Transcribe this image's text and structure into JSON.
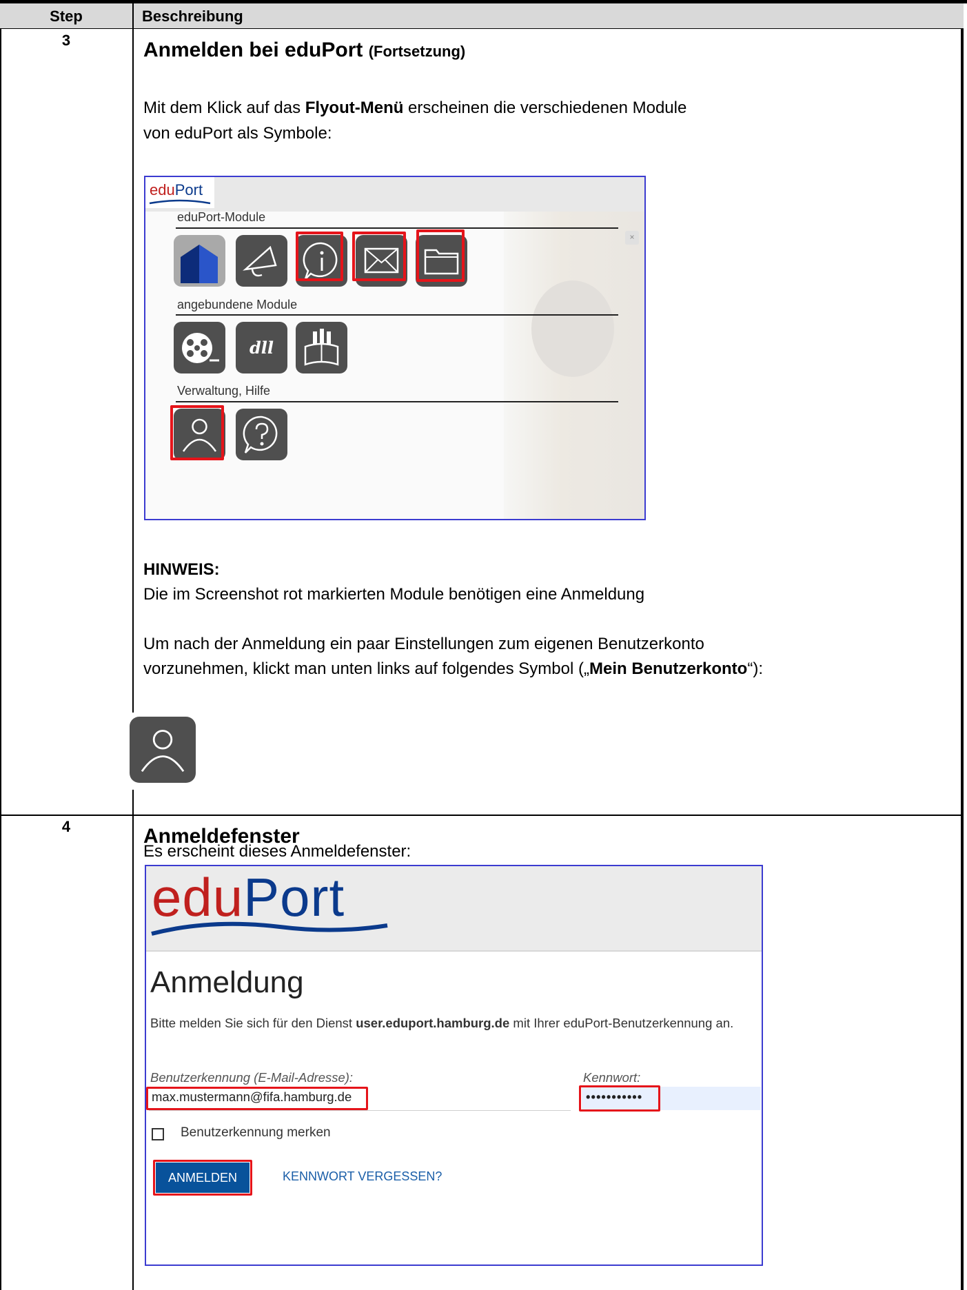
{
  "table": {
    "header_step": "Step",
    "header_description": "Beschreibung"
  },
  "step3": {
    "number": "3",
    "title": "Anmelden bei eduPort",
    "title_suffix": "(Fortsetzung)",
    "para1_a": "Mit dem Klick auf das ",
    "para1_bold": "Flyout-Menü",
    "para1_b": " erscheinen die verschiedenen Module",
    "para1_line2": "von eduPort als Symbole:",
    "flyout": {
      "logo_red": "edu",
      "logo_blue": "Port",
      "close": "×",
      "section1": "eduPort-Module",
      "section2": "angebundene Module",
      "section3": "Verwaltung, Hilfe",
      "icons_section1": [
        "home-icon",
        "megaphone-icon",
        "info-icon",
        "mail-icon",
        "folder-icon"
      ],
      "icons_section2": [
        "film-reel-icon",
        "dll-icon",
        "hamburg-book-icon"
      ],
      "icons_section3": [
        "user-icon",
        "help-icon"
      ],
      "icon_tile_color": "#4f4f4f",
      "highlight_color": "#e5141a",
      "dll_text": "dll"
    },
    "hint_title": "HINWEIS:",
    "hint_text": "Die im Screenshot rot markierten Module benötigen eine Anmeldung",
    "para2_line1": "Um nach der Anmeldung ein paar Einstellungen zum eigenen Benutzerkonto",
    "para2_line2_a": "vorzunehmen, klickt man unten links auf folgendes Symbol („",
    "para2_line2_bold": "Mein Benutzerkonto",
    "para2_line2_b": "“):"
  },
  "step4": {
    "number": "4",
    "title": "Anmeldefenster",
    "intro": "Es erscheint dieses Anmeldefenster:",
    "login": {
      "logo_red": "edu",
      "logo_blue": "Port",
      "heading": "Anmeldung",
      "text_a": "Bitte melden Sie sich für den Dienst ",
      "text_bold": "user.eduport.hamburg.de",
      "text_b": " mit Ihrer eduPort-Benutzerkennung an.",
      "user_label": "Benutzerkennung (E-Mail-Adresse):",
      "user_value": "max.mustermann@fifa.hamburg.de",
      "pass_label": "Kennwort:",
      "pass_value": "•••••••••••",
      "remember_label": "Benutzerkennung merken",
      "login_button": "ANMELDEN",
      "forgot_link": "KENNWORT VERGESSEN?"
    }
  }
}
